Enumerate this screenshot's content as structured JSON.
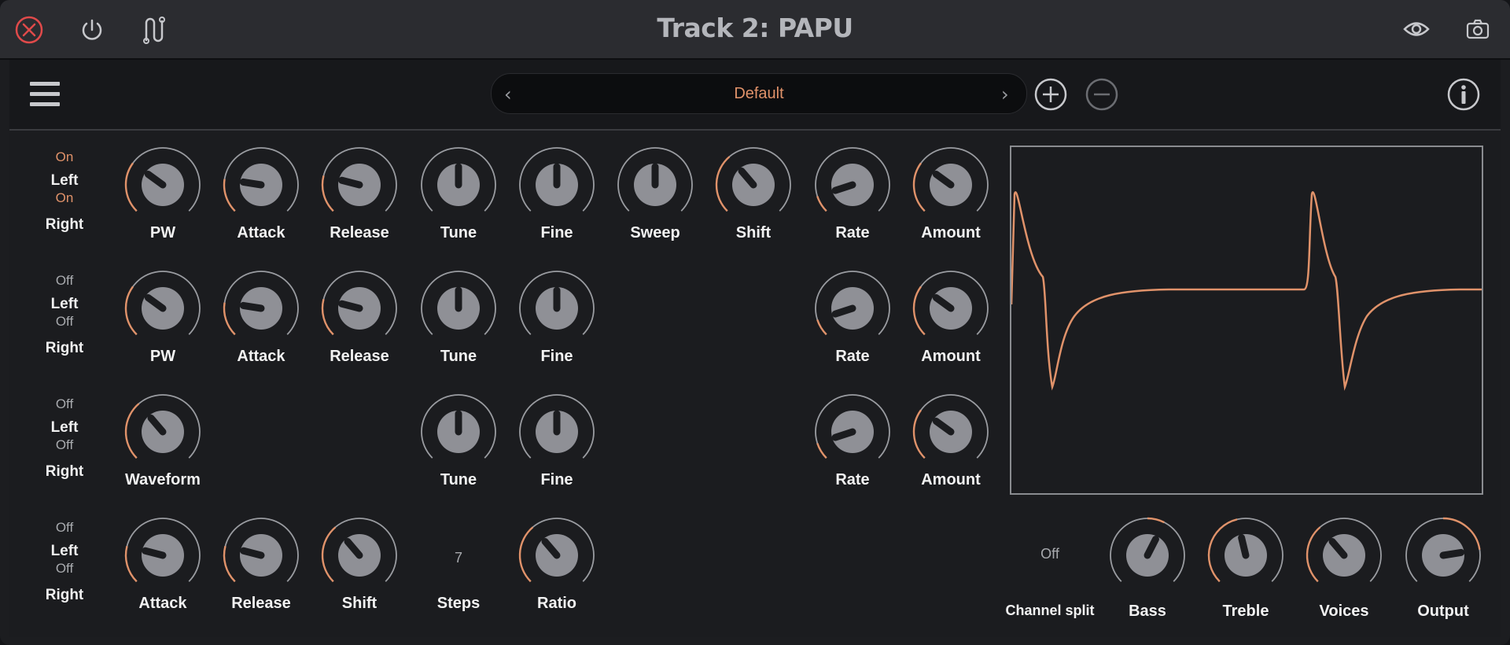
{
  "window": {
    "title": "Track 2: PAPU",
    "icons": [
      "close-icon",
      "power-icon",
      "routing-icon",
      "eye-icon",
      "camera-icon"
    ]
  },
  "toolbar": {
    "preset": "Default",
    "icons": [
      "menu-icon",
      "chevron-left-icon",
      "chevron-right-icon",
      "add-icon",
      "remove-icon",
      "info-icon"
    ]
  },
  "colors": {
    "accent": "#e0926a",
    "knob_face": "#8f9096",
    "ring": "#9a9ca1",
    "background": "#1b1c1f"
  },
  "rows": [
    {
      "state_left": "On",
      "state_right": "On",
      "left_label": "Left",
      "right_label": "Right",
      "knobs": [
        {
          "label": "PW",
          "value": 0.3
        },
        {
          "label": "Attack",
          "value": 0.2
        },
        {
          "label": "Release",
          "value": 0.22
        },
        {
          "label": "Tune",
          "value": 0.5
        },
        {
          "label": "Fine",
          "value": 0.5
        },
        {
          "label": "Sweep",
          "value": 0.5
        },
        {
          "label": "Shift",
          "value": 0.35
        },
        {
          "label": "Rate",
          "value": 0.1
        },
        {
          "label": "Amount",
          "value": 0.3
        }
      ]
    },
    {
      "state_left": "Off",
      "state_right": "Off",
      "left_label": "Left",
      "right_label": "Right",
      "knobs": [
        {
          "label": "PW",
          "value": 0.3
        },
        {
          "label": "Attack",
          "value": 0.2
        },
        {
          "label": "Release",
          "value": 0.22
        },
        {
          "label": "Tune",
          "value": 0.5
        },
        {
          "label": "Fine",
          "value": 0.5
        },
        {
          "label": "Rate",
          "value": 0.1
        },
        {
          "label": "Amount",
          "value": 0.3
        }
      ]
    },
    {
      "state_left": "Off",
      "state_right": "Off",
      "left_label": "Left",
      "right_label": "Right",
      "knobs": [
        {
          "label": "Waveform",
          "value": 0.35
        },
        {
          "label": "Tune",
          "value": 0.5
        },
        {
          "label": "Fine",
          "value": 0.5
        },
        {
          "label": "Rate",
          "value": 0.1
        },
        {
          "label": "Amount",
          "value": 0.3
        }
      ]
    },
    {
      "state_left": "Off",
      "state_right": "Off",
      "left_label": "Left",
      "right_label": "Right",
      "knobs": [
        {
          "label": "Attack",
          "value": 0.22
        },
        {
          "label": "Release",
          "value": 0.22
        },
        {
          "label": "Shift",
          "value": 0.35
        },
        {
          "label": "Steps",
          "value_text": "7"
        },
        {
          "label": "Ratio",
          "value": 0.35
        }
      ]
    }
  ],
  "output_section": {
    "channel_split": {
      "label": "Channel split",
      "state": "Off"
    },
    "knobs": [
      {
        "label": "Bass",
        "value": 0.6
      },
      {
        "label": "Treble",
        "value": 0.45
      },
      {
        "label": "Voices",
        "value": 0.35
      },
      {
        "label": "Output",
        "value": 0.8
      }
    ]
  }
}
